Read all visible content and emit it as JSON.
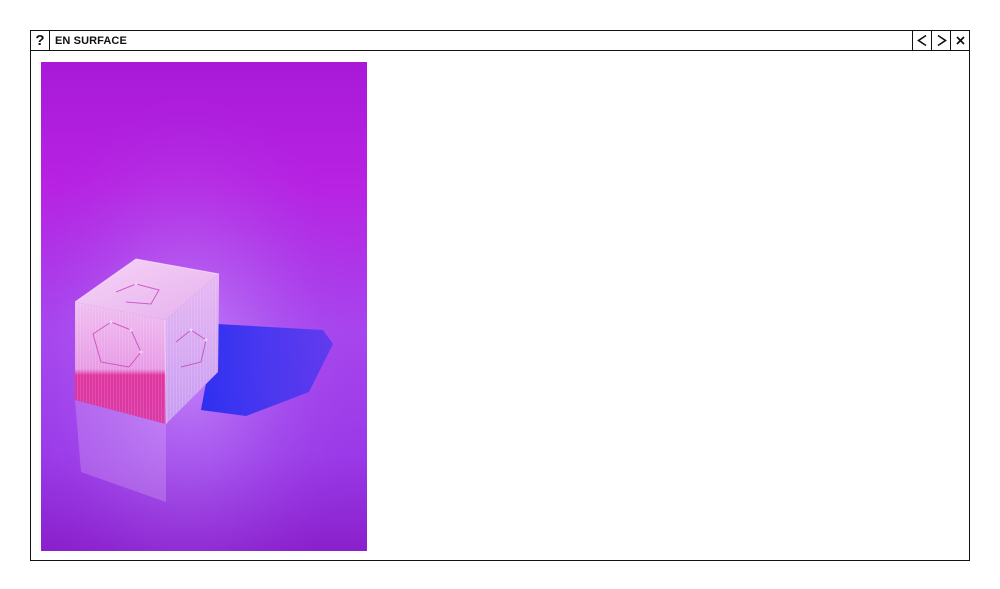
{
  "window": {
    "title": "EN SURFACE",
    "help_label": "?",
    "help_icon": "question-mark-icon",
    "prev_icon": "chevron-left-icon",
    "next_icon": "chevron-right-icon",
    "close_icon": "close-icon"
  },
  "content": {
    "image": {
      "subject": "acrylic-cube-photo",
      "colors": {
        "top": "#b81fe0",
        "middle": "#a044ee",
        "bottom": "#8c22d0",
        "shadow": "#2a2cf0",
        "cube_light": "#f0c6f4",
        "cube_pink": "#e0359f"
      }
    }
  }
}
